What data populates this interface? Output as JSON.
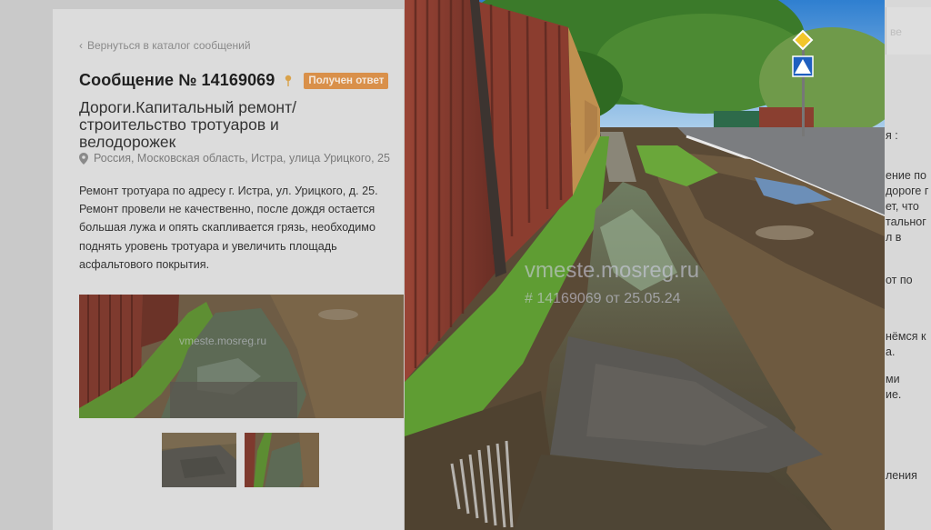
{
  "back_link": "Вернуться в каталог сообщений",
  "message": {
    "title": "Сообщение № 14169069",
    "status_badge": "Получен ответ",
    "category": "Дороги.Капитальный ремонт/строительство тротуаров и велодорожек",
    "address": "Россия, Московская область, Истра, улица Урицкого, 25",
    "description": "Ремонт тротуара по адресу г. Истра, ул. Урицкого, д. 25. Ремонт провели не качественно, после дождя остается большая лужа и опять скапливается грязь, необходимо поднять уровень тротуара и увеличить площадь асфальтового покрытия."
  },
  "photo_watermark": {
    "site": "vmeste.mosreg.ru",
    "caption": "# 14169069 от 25.05.24"
  },
  "thumbs_watermark": "vmeste.mosreg.ru",
  "right_panel": {
    "input_placeholder": "ве",
    "fragments": [
      "я :",
      "ение по",
      "дороге г",
      "ет, что",
      "тальног",
      "л в",
      "от по",
      "нёмся к",
      "а.",
      "ми",
      "ие.",
      "ления"
    ]
  },
  "colors": {
    "badge": "#d9904a",
    "fence": "#8b3d2f",
    "grass": "#6aa73a",
    "sky": "#3a8bd6"
  },
  "icons": {
    "back": "chevron-left-icon",
    "pin": "pin-icon",
    "location": "location-pin-icon",
    "crosswalk_sign": "pedestrian-crossing-sign-icon",
    "priority_sign": "priority-road-sign-icon"
  }
}
